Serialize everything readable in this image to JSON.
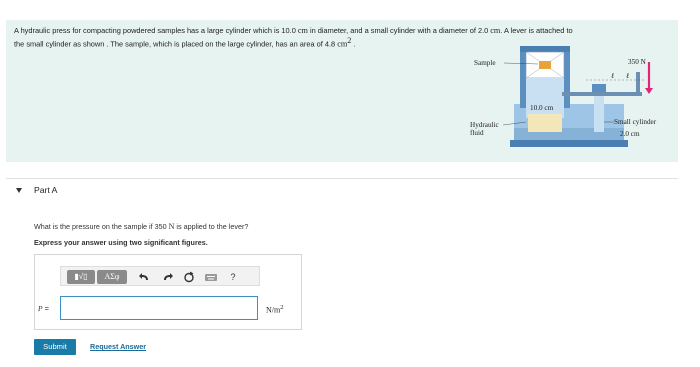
{
  "problem": {
    "text_a": "A hydraulic press for compacting powdered samples has a large cylinder which is 10.0 ",
    "unit_a": "cm",
    "text_b": " in diameter, and a small cylinder with a diameter of 2.0 ",
    "unit_b": "cm",
    "text_c": ". A lever is attached to",
    "text_d": "the small cylinder as shown . The sample, which is placed on the large cylinder, has an area of 4.8 ",
    "unit_area": "cm",
    "unit_area_exp": "2",
    "text_e": " ."
  },
  "figure": {
    "sample_label": "Sample",
    "fluid_label_1": "Hydraulic",
    "fluid_label_2": "fluid",
    "large_diameter_label": "10.0 cm",
    "small_label_1": "Small cylinder",
    "small_label_2": "2.0 cm",
    "force_label": "350 N",
    "lever_mark": "ℓ"
  },
  "part": {
    "title": "Part A",
    "question_a": "What is the pressure on the sample if 350 ",
    "question_unit": "N",
    "question_b": " is applied to the lever?",
    "instruction": "Express your answer using two significant figures."
  },
  "toolbar": {
    "templates_label": "▮√▯",
    "greek_label": "ΑΣφ",
    "help_label": "?"
  },
  "answer": {
    "variable": "P",
    "equals": " =",
    "value": "",
    "unit": "N/m",
    "unit_exp": "2"
  },
  "actions": {
    "submit_label": "Submit",
    "request_label": "Request Answer"
  }
}
